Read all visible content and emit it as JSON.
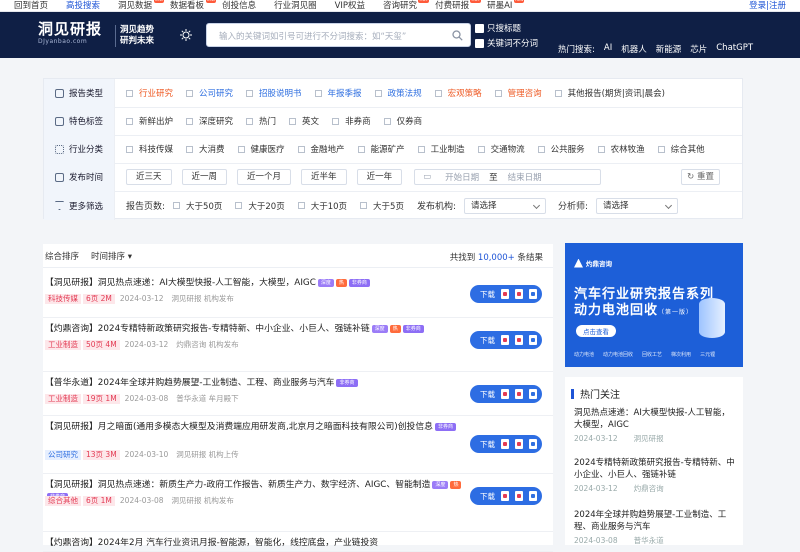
{
  "topnav": {
    "items": [
      {
        "label": "回到首页"
      },
      {
        "label": "高投搜索"
      },
      {
        "label": "洞见数据",
        "tag": "new"
      },
      {
        "label": "数据看板",
        "tag": "new"
      },
      {
        "label": "创投信息"
      },
      {
        "label": "行业洞见圈"
      },
      {
        "label": "VIP权益"
      },
      {
        "label": "咨询研究",
        "tag": "HOT"
      },
      {
        "label": "付费研报",
        "tag": "HOT"
      },
      {
        "label": "研墨AI",
        "tag": "new"
      }
    ],
    "login": "登录|注册"
  },
  "header": {
    "logo_main": "洞见研报",
    "logo_sub": "DJyanbao.com",
    "slogan_line1": "洞见趋势",
    "slogan_line2": "研判未来",
    "search_placeholder": "输入的关键词如引号可进行不分词搜索：如“天玺”",
    "check_title_only": "只搜标题",
    "check_no_segment": "关键词不分词",
    "hot_label": "热门搜索:",
    "hot_terms": [
      "AI",
      "机器人",
      "新能源",
      "芯片",
      "ChatGPT"
    ]
  },
  "filters": {
    "report_type": {
      "label": "报告类型",
      "options": [
        "行业研究",
        "公司研究",
        "招股说明书",
        "年报季报",
        "政策法规",
        "宏观策略",
        "管理咨询",
        "其他报告(期货|资讯|晨会)"
      ]
    },
    "features": {
      "label": "特色标签",
      "options": [
        "新鲜出炉",
        "深度研究",
        "热门",
        "英文",
        "非券商",
        "仅券商"
      ]
    },
    "industry": {
      "label": "行业分类",
      "options": [
        "科技传媒",
        "大消费",
        "健康医疗",
        "金融地产",
        "能源矿产",
        "工业制造",
        "交通物流",
        "公共服务",
        "农林牧渔",
        "综合其他"
      ]
    },
    "publish_time": {
      "label": "发布时间",
      "options": [
        "近三天",
        "近一周",
        "近一个月",
        "近半年",
        "近一年"
      ],
      "start_placeholder": "开始日期",
      "to": "至",
      "end_placeholder": "结束日期",
      "reset": "重置"
    },
    "more": {
      "label": "更多筛选",
      "pages_label": "报告页数:",
      "pages_options": [
        "大于50页",
        "大于20页",
        "大于10页",
        "大于5页"
      ],
      "org_label": "发布机构:",
      "org_value": "请选择",
      "analyst_label": "分析师:",
      "analyst_value": "请选择"
    }
  },
  "results": {
    "sort_all": "综合排序",
    "sort_time": "时间排序",
    "total_prefix": "共找到",
    "total_count": "10,000+",
    "total_suffix": "条结果",
    "download_label": "下载",
    "items": [
      {
        "title": "【洞见研报】洞见热点速递：AI大模型快报-人工智能，大模型，AIGC",
        "badges": [
          "深度",
          "热",
          "非券商"
        ],
        "category": "科技传媒",
        "pages": "6页 2M",
        "date": "2024-03-12",
        "org": "洞见研报 机构发布"
      },
      {
        "title": "【灼鼎咨询】2024专精特新政策研究报告-专精特新、中小企业、小巨人、强链补链",
        "badges": [
          "深度",
          "热",
          "非券商"
        ],
        "category": "工业制造",
        "pages": "50页 4M",
        "date": "2024-03-12",
        "org": "灼鼎咨询 机构发布"
      },
      {
        "title": "【普华永道】2024年全球并购趋势展望-工业制造、工程、商业服务与汽车",
        "badges": [
          "非券商"
        ],
        "category": "工业制造",
        "pages": "19页 1M",
        "date": "2024-03-08",
        "org": "普华永道 牟月殿下"
      },
      {
        "title": "【洞见研报】月之暗面(通用多模态大模型及消费端应用研发商,北京月之暗面科技有限公司)创投信息",
        "badges": [
          "非券商"
        ],
        "category": "公司研究",
        "pages": "13页 3M",
        "date": "2024-03-10",
        "org": "洞见研报 机构上传"
      },
      {
        "title": "【洞见研报】洞见热点速递：新质生产力-政府工作报告、新质生产力、数字经济、AIGC、智能制造",
        "badges": [
          "深度",
          "热",
          "非券商"
        ],
        "category": "综合其他",
        "pages": "6页 1M",
        "date": "2024-03-08",
        "org": "洞见研报 机构发布"
      },
      {
        "title": "【灼鼎咨询】2024年2月 汽车行业资讯月报-智能源，智能化，线控底盘，产业链投资",
        "badges": [],
        "category": "",
        "pages": "",
        "date": "",
        "org": ""
      }
    ]
  },
  "banner": {
    "brand": "灼鼎咨询",
    "title_line1": "汽车行业研究报告系列",
    "title_line2": "动力电池回收",
    "issue": "（第一版）",
    "cta": "点击查看",
    "footer": [
      "动力电池",
      "动力电池回收",
      "回收工艺",
      "梯次利用",
      "三元锂"
    ]
  },
  "hot_panel": {
    "title": "热门关注",
    "items": [
      {
        "title": "洞见热点速递：AI大模型快报-人工智能，大模型，AIGC",
        "date": "2024-03-12",
        "org": "洞见研报"
      },
      {
        "title": "2024专精特新政策研究报告-专精特新、中小企业、小巨人、强链补链",
        "date": "2024-03-12",
        "org": "灼鼎咨询"
      },
      {
        "title": "2024年全球并购趋势展望-工业制造、工程、商业服务与汽车",
        "date": "2024-03-08",
        "org": "普华永道"
      }
    ]
  },
  "colors": {
    "accent": "#1e54d6",
    "hero_bg": "#0f1f45",
    "download": "#2d6de3",
    "hot_tag": "#ff5a3a"
  }
}
